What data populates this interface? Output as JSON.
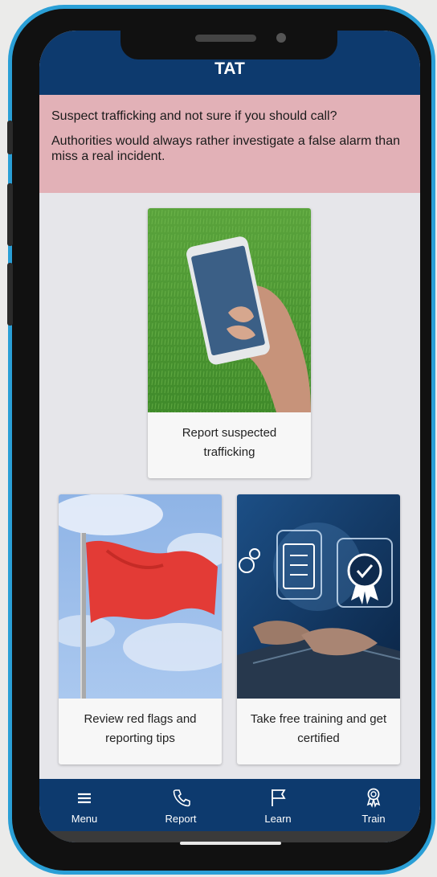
{
  "app": {
    "title": "TAT"
  },
  "banner": {
    "line1": "Suspect trafficking and not sure if you should call?",
    "line2": "Authorities would always rather investigate a false alarm than miss a real incident."
  },
  "cards": {
    "report": {
      "label": "Report suspected trafficking",
      "image": "phone-in-hand-photo"
    },
    "red_flags": {
      "label": "Review red flags and reporting tips",
      "image": "red-flag-photo"
    },
    "training": {
      "label": "Take free training and get certified",
      "image": "laptop-certificate-photo"
    }
  },
  "nav": {
    "menu": {
      "label": "Menu",
      "icon": "menu-icon"
    },
    "report": {
      "label": "Report",
      "icon": "phone-icon"
    },
    "learn": {
      "label": "Learn",
      "icon": "flag-icon"
    },
    "train": {
      "label": "Train",
      "icon": "award-icon"
    }
  },
  "colors": {
    "header": "#0d3a6e",
    "banner": "#e2b1b7",
    "frame": "#2a9fd6",
    "background": "#e6e6ea"
  }
}
